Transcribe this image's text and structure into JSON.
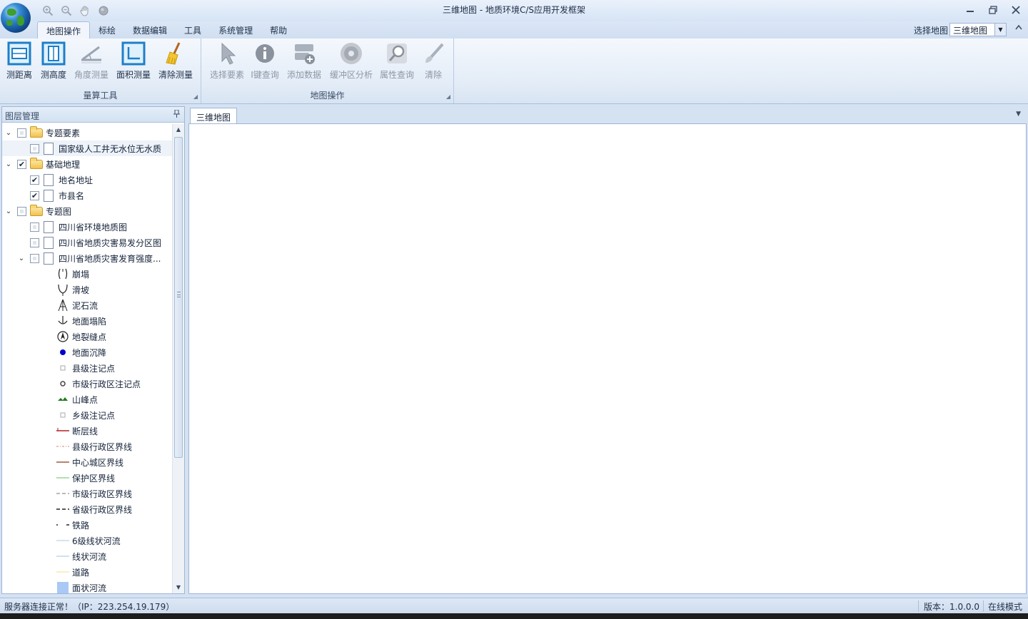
{
  "window": {
    "title": "三维地图 - 地质环境C/S应用开发框架"
  },
  "quick_access": [
    "zoom-in-icon",
    "zoom-out-icon",
    "pan-hand-icon",
    "full-extent-icon"
  ],
  "menu": {
    "tabs": [
      "地图操作",
      "标绘",
      "数据编辑",
      "工具",
      "系统管理",
      "帮助"
    ],
    "active_tab": "地图操作",
    "map_select_label": "选择地图",
    "map_select_value": "三维地图"
  },
  "ribbon": {
    "groups": [
      {
        "title": "量算工具",
        "buttons": [
          {
            "label": "测距离",
            "icon": "measure-distance-icon",
            "enabled": true
          },
          {
            "label": "测高度",
            "icon": "measure-height-icon",
            "enabled": true
          },
          {
            "label": "角度测量",
            "icon": "measure-angle-icon",
            "enabled": false
          },
          {
            "label": "面积测量",
            "icon": "measure-area-icon",
            "enabled": true
          },
          {
            "label": "清除测量",
            "icon": "broom-icon",
            "enabled": true
          }
        ]
      },
      {
        "title": "地图操作",
        "buttons": [
          {
            "label": "选择要素",
            "icon": "select-arrow-icon",
            "enabled": false
          },
          {
            "label": "I键查询",
            "icon": "info-icon",
            "enabled": false
          },
          {
            "label": "添加数据",
            "icon": "add-data-icon",
            "enabled": false
          },
          {
            "label": "缓冲区分析",
            "icon": "buffer-icon",
            "enabled": false
          },
          {
            "label": "属性查询",
            "icon": "magnifier-icon",
            "enabled": false
          },
          {
            "label": "清除",
            "icon": "eraser-icon",
            "enabled": false
          }
        ]
      }
    ]
  },
  "layer_panel": {
    "title": "图层管理",
    "tree": [
      {
        "type": "group",
        "label": "专题要素",
        "checked": "unknown",
        "expanded": true
      },
      {
        "type": "layer",
        "label": "国家级人工井无水位无水质",
        "checked": false
      },
      {
        "type": "group",
        "label": "基础地理",
        "checked": true,
        "expanded": true
      },
      {
        "type": "layer",
        "label": "地名地址",
        "checked": true
      },
      {
        "type": "layer",
        "label": "市县名",
        "checked": true
      },
      {
        "type": "group",
        "label": "专题图",
        "checked": "unknown",
        "expanded": true
      },
      {
        "type": "layer",
        "label": "四川省环境地质图",
        "checked": false
      },
      {
        "type": "layer",
        "label": "四川省地质灾害易发分区图",
        "checked": false
      },
      {
        "type": "layer",
        "label": "四川省地质灾害发育强度...",
        "checked": false,
        "expanded": true
      },
      {
        "type": "legend",
        "label": "崩塌",
        "symbol": "collapse-symbol-icon"
      },
      {
        "type": "legend",
        "label": "滑坡",
        "symbol": "landslide-symbol-icon"
      },
      {
        "type": "legend",
        "label": "泥石流",
        "symbol": "debris-flow-symbol-icon"
      },
      {
        "type": "legend",
        "label": "地面塌陷",
        "symbol": "ground-collapse-symbol-icon"
      },
      {
        "type": "legend",
        "label": "地裂缝点",
        "symbol": "ground-fissure-symbol-icon"
      },
      {
        "type": "legend",
        "label": "地面沉降",
        "symbol": "subsidence-dot-icon",
        "color": "#0000cc"
      },
      {
        "type": "legend",
        "label": "县级注记点",
        "symbol": "county-point-icon"
      },
      {
        "type": "legend",
        "label": "市级行政区注记点",
        "symbol": "city-point-icon"
      },
      {
        "type": "legend",
        "label": "山峰点",
        "symbol": "peak-symbol-icon",
        "color": "#1f7a1f"
      },
      {
        "type": "legend",
        "label": "乡级注记点",
        "symbol": "township-point-icon"
      },
      {
        "type": "legend",
        "label": "断层线",
        "symbol": "fault-line-icon",
        "color": "#b22222"
      },
      {
        "type": "legend",
        "label": "县级行政区界线",
        "symbol": "county-boundary-line-icon",
        "color": "#d08080"
      },
      {
        "type": "legend",
        "label": "中心城区界线",
        "symbol": "urban-boundary-line-icon",
        "color": "#8b3a1a"
      },
      {
        "type": "legend",
        "label": "保护区界线",
        "symbol": "reserve-boundary-line-icon",
        "color": "#7fcf7f"
      },
      {
        "type": "legend",
        "label": "市级行政区界线",
        "symbol": "city-boundary-line-icon",
        "color": "#777777"
      },
      {
        "type": "legend",
        "label": "省级行政区界线",
        "symbol": "province-boundary-line-icon",
        "color": "#222222"
      },
      {
        "type": "legend",
        "label": "铁路",
        "symbol": "railway-line-icon",
        "color": "#222222"
      },
      {
        "type": "legend",
        "label": "6级线状河流",
        "symbol": "river-level6-line-icon",
        "color": "#a8c8e8"
      },
      {
        "type": "legend",
        "label": "线状河流",
        "symbol": "river-line-icon",
        "color": "#9ec3e6"
      },
      {
        "type": "legend",
        "label": "道路",
        "symbol": "road-line-icon",
        "color": "#f0e080"
      },
      {
        "type": "legend",
        "label": "面状河流",
        "symbol": "river-area-icon",
        "color": "#a9c8f5"
      }
    ]
  },
  "document": {
    "tab_label": "三维地图"
  },
  "statusbar": {
    "connection": "服务器连接正常！（IP：223.254.19.179）",
    "version": "版本：1.0.0.0",
    "mode": "在线模式"
  }
}
